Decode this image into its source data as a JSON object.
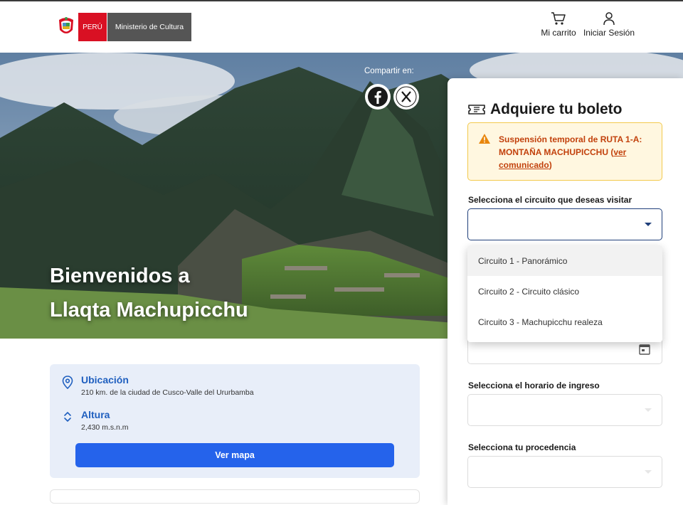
{
  "header": {
    "peru_label": "PERÚ",
    "ministerio_label": "Ministerio de Cultura",
    "cart_label": "Mi carrito",
    "login_label": "Iniciar Sesión"
  },
  "hero": {
    "title_line1": "Bienvenidos a",
    "title_line2": "Llaqta Machupicchu",
    "share_label": "Compartir en:",
    "social": [
      "facebook-icon",
      "x-icon"
    ]
  },
  "info": {
    "location_title": "Ubicación",
    "location_text": "210 km. de la ciudad de Cusco-Valle del Ururbamba",
    "altitude_title": "Altura",
    "altitude_text": "2,430 m.s.n.m",
    "map_button": "Ver mapa"
  },
  "ticket": {
    "title": "Adquiere tu boleto",
    "alert_text": "Suspensión temporal de RUTA 1-A: MONTAÑA MACHUPICCHU",
    "alert_link_open": "(",
    "alert_link": "ver comunicado",
    "alert_link_close": ")",
    "circuit_label": "Selecciona el circuito que deseas visitar",
    "circuit_value": "",
    "circuit_options": [
      "Circuito 1 - Panorámico",
      "Circuito 2 - Circuito clásico",
      "Circuito 3 - Machupicchu realeza"
    ],
    "schedule_label": "Selecciona el horario de ingreso",
    "origin_label": "Selecciona tu procedencia"
  },
  "colors": {
    "primary_blue": "#2563eb",
    "info_bg": "#e8eef9",
    "alert_bg": "#fff7e0",
    "alert_border": "#f2c94c",
    "alert_text": "#c2410c",
    "peru_red": "#d91023"
  }
}
